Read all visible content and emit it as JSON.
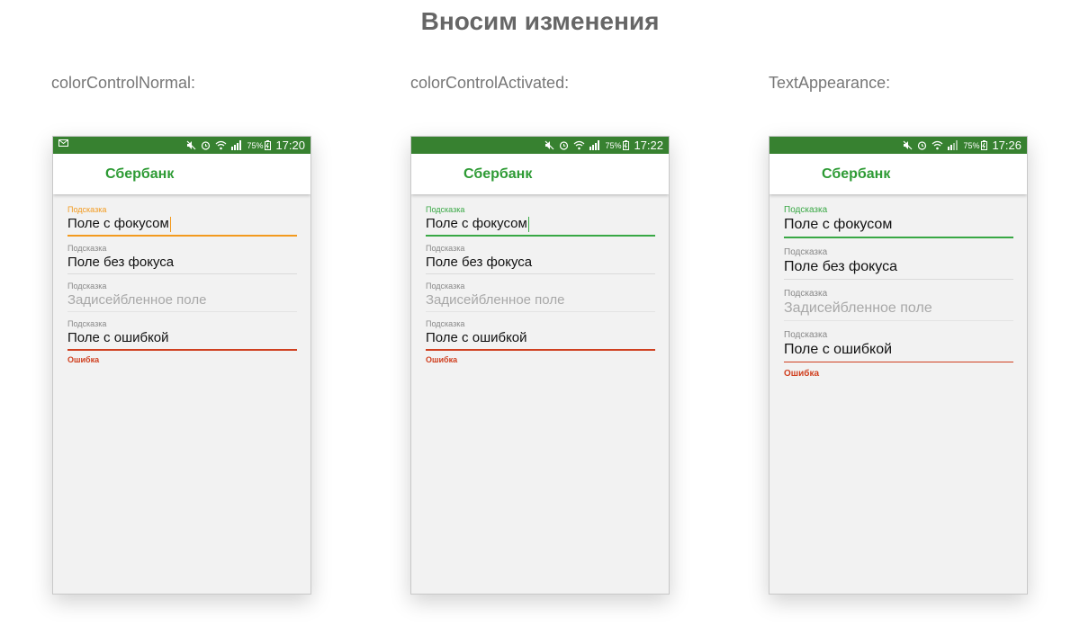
{
  "title": "Вносим изменения",
  "columns": [
    {
      "label": "colorControlNormal:",
      "time": "17:20",
      "battery": "75%",
      "app_title": "Сбербанк",
      "accent": "#f39a1e",
      "fields": {
        "focus": {
          "hint": "Подсказка",
          "value": "Поле с фокусом"
        },
        "normal": {
          "hint": "Подсказка",
          "value": "Поле без фокуса"
        },
        "disabled": {
          "hint": "Подсказка",
          "value": "Задисейбленное поле"
        },
        "error": {
          "hint": "Подсказка",
          "value": "Поле с ошибкой",
          "error": "Ошибка"
        }
      }
    },
    {
      "label": "colorControlActivated:",
      "time": "17:22",
      "battery": "75%",
      "app_title": "Сбербанк",
      "accent": "#39a845",
      "fields": {
        "focus": {
          "hint": "Подсказка",
          "value": "Поле с фокусом"
        },
        "normal": {
          "hint": "Подсказка",
          "value": "Поле без фокуса"
        },
        "disabled": {
          "hint": "Подсказка",
          "value": "Задисейбленное поле"
        },
        "error": {
          "hint": "Подсказка",
          "value": "Поле с ошибкой",
          "error": "Ошибка"
        }
      }
    },
    {
      "label": "TextAppearance:",
      "time": "17:26",
      "battery": "75%",
      "app_title": "Сбербанк",
      "accent": "#39a845",
      "fields": {
        "focus": {
          "hint": "Подсказка",
          "value": "Поле с фокусом"
        },
        "normal": {
          "hint": "Подсказка",
          "value": "Поле без фокуса"
        },
        "disabled": {
          "hint": "Подсказка",
          "value": "Задисейбленное поле"
        },
        "error": {
          "hint": "Подсказка",
          "value": "Поле с ошибкой",
          "error": "Ошибка"
        }
      }
    }
  ],
  "colors": {
    "status_bar": "#378130",
    "app_title": "#2e9b35",
    "error": "#d04020"
  },
  "icons": [
    "mail-icon",
    "mute-icon",
    "alarm-icon",
    "wifi-icon",
    "signal-icon",
    "battery-icon"
  ]
}
